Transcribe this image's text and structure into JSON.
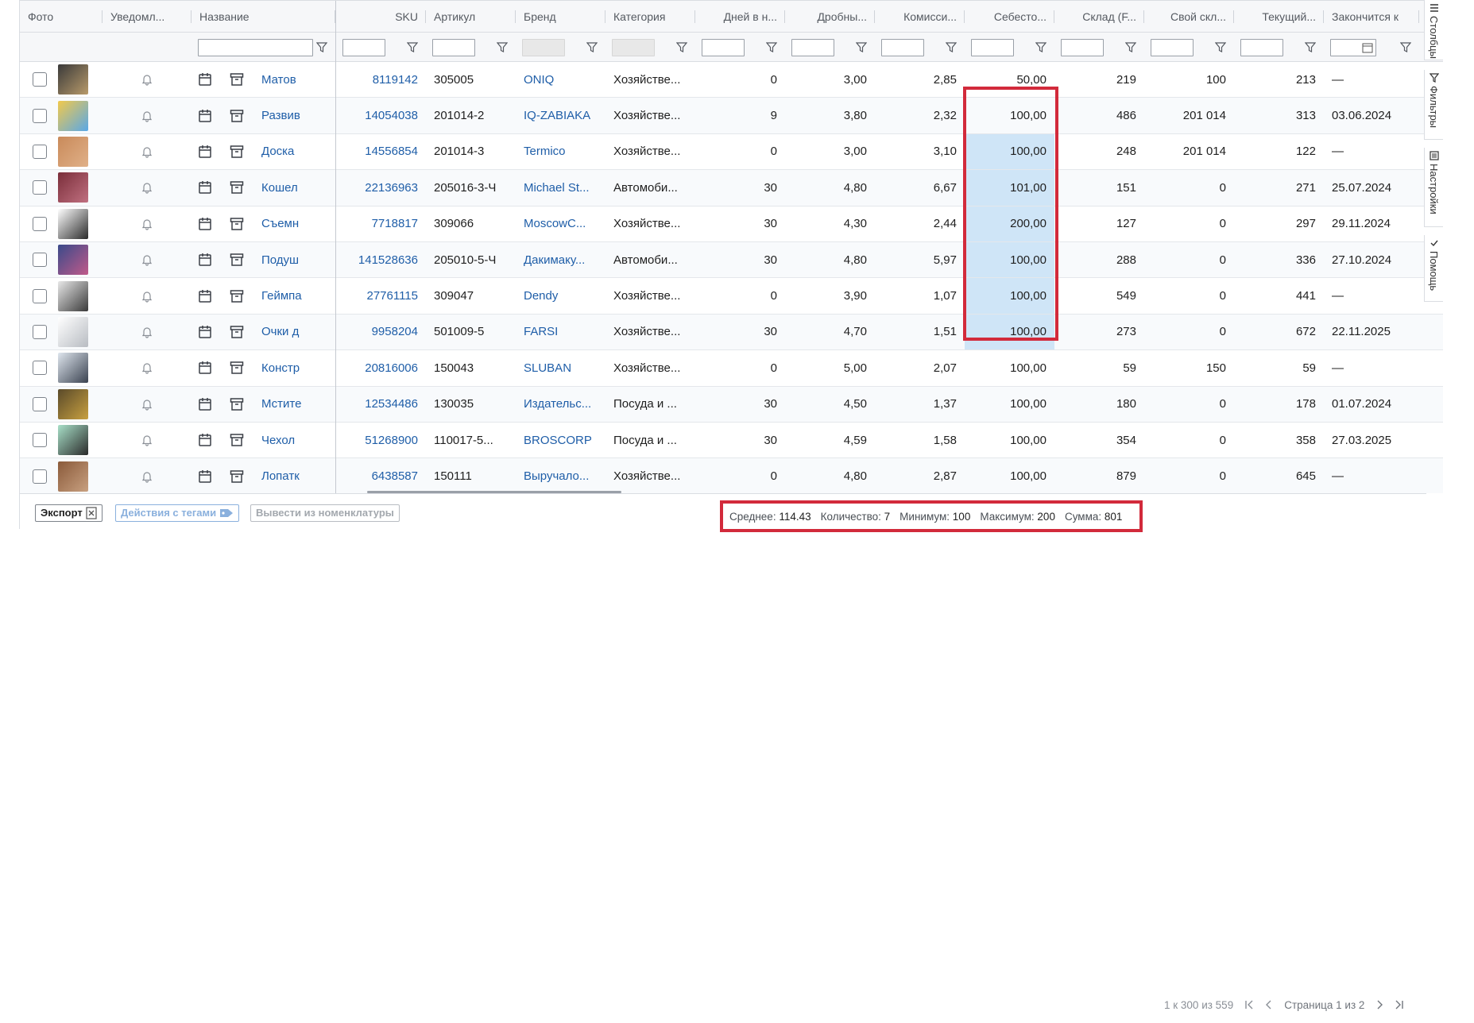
{
  "columns_left": [
    {
      "key": "photo",
      "label": "Фото",
      "width": 104
    },
    {
      "key": "notify",
      "label": "Уведомл...",
      "width": 112
    },
    {
      "key": "name",
      "label": "Название",
      "width": 181
    }
  ],
  "columns_right": [
    {
      "key": "sku",
      "label": "SKU",
      "width": 113,
      "align": "r"
    },
    {
      "key": "art",
      "label": "Артикул",
      "width": 113
    },
    {
      "key": "brand",
      "label": "Бренд",
      "width": 113
    },
    {
      "key": "cat",
      "label": "Категория",
      "width": 113
    },
    {
      "key": "days",
      "label": "Дней в н...",
      "width": 113,
      "align": "r"
    },
    {
      "key": "drob",
      "label": "Дробны...",
      "width": 113,
      "align": "r"
    },
    {
      "key": "comm",
      "label": "Комисси...",
      "width": 113,
      "align": "r"
    },
    {
      "key": "cost",
      "label": "Себесто...",
      "width": 113,
      "align": "r"
    },
    {
      "key": "stock",
      "label": "Склад (F...",
      "width": 113,
      "align": "r"
    },
    {
      "key": "own",
      "label": "Свой скл...",
      "width": 113,
      "align": "r"
    },
    {
      "key": "cur",
      "label": "Текущий...",
      "width": 113,
      "align": "r"
    },
    {
      "key": "end",
      "label": "Закончится к",
      "width": 120
    }
  ],
  "rows": [
    {
      "name": "Матов",
      "sku": "8119142",
      "art": "305005",
      "brand": "ONIQ",
      "cat": "Хозяйстве...",
      "days": "0",
      "drob": "3,00",
      "comm": "2,85",
      "cost": "50,00",
      "stock": "219",
      "own": "100",
      "cur": "213",
      "end": "—",
      "thumb": [
        "#3a3a3a",
        "#b89a6a"
      ],
      "selected": false
    },
    {
      "name": "Развив",
      "sku": "14054038",
      "art": "201014-2",
      "brand": "IQ-ZABIAKA",
      "cat": "Хозяйстве...",
      "days": "9",
      "drob": "3,80",
      "comm": "2,32",
      "cost": "100,00",
      "stock": "486",
      "own": "201 014",
      "cur": "313",
      "end": "03.06.2024",
      "thumb": [
        "#f2c94c",
        "#5aa8e6"
      ],
      "selected": false
    },
    {
      "name": "Доска",
      "sku": "14556854",
      "art": "201014-3",
      "brand": "Termico",
      "cat": "Хозяйстве...",
      "days": "0",
      "drob": "3,00",
      "comm": "3,10",
      "cost": "100,00",
      "stock": "248",
      "own": "201 014",
      "cur": "122",
      "end": "—",
      "thumb": [
        "#c98a5a",
        "#e0b088"
      ],
      "selected": true
    },
    {
      "name": "Кошел",
      "sku": "22136963",
      "art": "205016-3-Ч",
      "brand": "Michael St...",
      "cat": "Автомоби...",
      "days": "30",
      "drob": "4,80",
      "comm": "6,67",
      "cost": "101,00",
      "stock": "151",
      "own": "0",
      "cur": "271",
      "end": "25.07.2024",
      "thumb": [
        "#7a2e3a",
        "#c07080"
      ],
      "selected": true
    },
    {
      "name": "Съемн",
      "sku": "7718817",
      "art": "309066",
      "brand": "MoscowC...",
      "cat": "Хозяйстве...",
      "days": "30",
      "drob": "4,30",
      "comm": "2,44",
      "cost": "200,00",
      "stock": "127",
      "own": "0",
      "cur": "297",
      "end": "29.11.2024",
      "thumb": [
        "#ffffff",
        "#2a2a2a"
      ],
      "selected": true
    },
    {
      "name": "Подуш",
      "sku": "141528636",
      "art": "205010-5-Ч",
      "brand": "Дакимаку...",
      "cat": "Автомоби...",
      "days": "30",
      "drob": "4,80",
      "comm": "5,97",
      "cost": "100,00",
      "stock": "288",
      "own": "0",
      "cur": "336",
      "end": "27.10.2024",
      "thumb": [
        "#3a4a8a",
        "#c05a8a"
      ],
      "selected": true
    },
    {
      "name": "Геймпа",
      "sku": "27761115",
      "art": "309047",
      "brand": "Dendy",
      "cat": "Хозяйстве...",
      "days": "0",
      "drob": "3,90",
      "comm": "1,07",
      "cost": "100,00",
      "stock": "549",
      "own": "0",
      "cur": "441",
      "end": "—",
      "thumb": [
        "#e8e8e8",
        "#3a3a3a"
      ],
      "selected": true
    },
    {
      "name": "Очки д",
      "sku": "9958204",
      "art": "501009-5",
      "brand": "FARSI",
      "cat": "Хозяйстве...",
      "days": "30",
      "drob": "4,70",
      "comm": "1,51",
      "cost": "100,00",
      "stock": "273",
      "own": "0",
      "cur": "672",
      "end": "22.11.2025",
      "thumb": [
        "#ffffff",
        "#b8bcc2"
      ],
      "selected": true
    },
    {
      "name": "Констр",
      "sku": "20816006",
      "art": "150043",
      "brand": "SLUBAN",
      "cat": "Хозяйстве...",
      "days": "0",
      "drob": "5,00",
      "comm": "2,07",
      "cost": "100,00",
      "stock": "59",
      "own": "150",
      "cur": "59",
      "end": "—",
      "thumb": [
        "#dfe6ee",
        "#3a4250"
      ],
      "selected": false
    },
    {
      "name": "Мстите",
      "sku": "12534486",
      "art": "130035",
      "brand": "Издательс...",
      "cat": "Посуда и ...",
      "days": "30",
      "drob": "4,50",
      "comm": "1,37",
      "cost": "100,00",
      "stock": "180",
      "own": "0",
      "cur": "178",
      "end": "01.07.2024",
      "thumb": [
        "#5a4a2a",
        "#c8a040"
      ],
      "selected": false
    },
    {
      "name": "Чехол",
      "sku": "51268900",
      "art": "110017-5...",
      "brand": "BROSCORP",
      "cat": "Посуда и ...",
      "days": "30",
      "drob": "4,59",
      "comm": "1,58",
      "cost": "100,00",
      "stock": "354",
      "own": "0",
      "cur": "358",
      "end": "27.03.2025",
      "thumb": [
        "#a8e0c8",
        "#2a2a2a"
      ],
      "selected": false
    },
    {
      "name": "Лопатк",
      "sku": "6438587",
      "art": "150111",
      "brand": "Выручало...",
      "cat": "Хозяйстве...",
      "days": "0",
      "drob": "4,80",
      "comm": "2,87",
      "cost": "100,00",
      "stock": "879",
      "own": "0",
      "cur": "645",
      "end": "—",
      "thumb": [
        "#8a5a3a",
        "#c8a080"
      ],
      "selected": false
    }
  ],
  "footer": {
    "export_label": "Экспорт",
    "tags_label": "Действия с тегами",
    "remove_label": "Вывести из номенклатуры",
    "stats": {
      "avg_label": "Среднее:",
      "avg": "114.43",
      "count_label": "Количество:",
      "count": "7",
      "min_label": "Минимум:",
      "min": "100",
      "max_label": "Максимум:",
      "max": "200",
      "sum_label": "Сумма:",
      "sum": "801"
    },
    "range": "1 к 300 из 559",
    "page": "Страница 1 из 2"
  },
  "sidebar": [
    {
      "label": "Столбцы",
      "icon": "columns-icon"
    },
    {
      "label": "Фильтры",
      "icon": "filter-icon"
    },
    {
      "label": "Настройки",
      "icon": "settings-icon"
    },
    {
      "label": "Помощь",
      "icon": "help-icon"
    }
  ],
  "colors": {
    "accent": "#1f5ea8",
    "selection": "#cfe5f7",
    "highlight": "#d22a3b"
  }
}
